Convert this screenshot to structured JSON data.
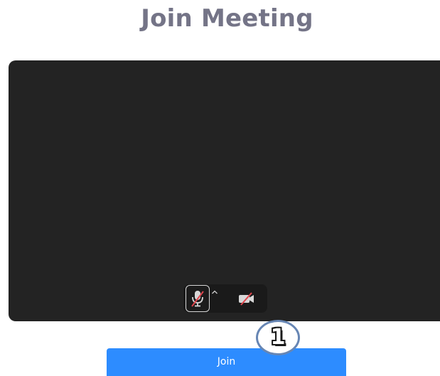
{
  "page": {
    "title": "Join Meeting"
  },
  "preview": {
    "mic": {
      "state": "muted",
      "icon": "mic-muted-icon"
    },
    "audio_options": {
      "icon": "caret-up-icon"
    },
    "camera": {
      "state": "off",
      "icon": "camera-off-icon"
    }
  },
  "join": {
    "label": "Join",
    "color": "#2d8cff"
  },
  "annotation": {
    "step": "1"
  },
  "colors": {
    "title": "#747487",
    "preview_bg": "#232323",
    "muted_slash": "#e0454c"
  }
}
